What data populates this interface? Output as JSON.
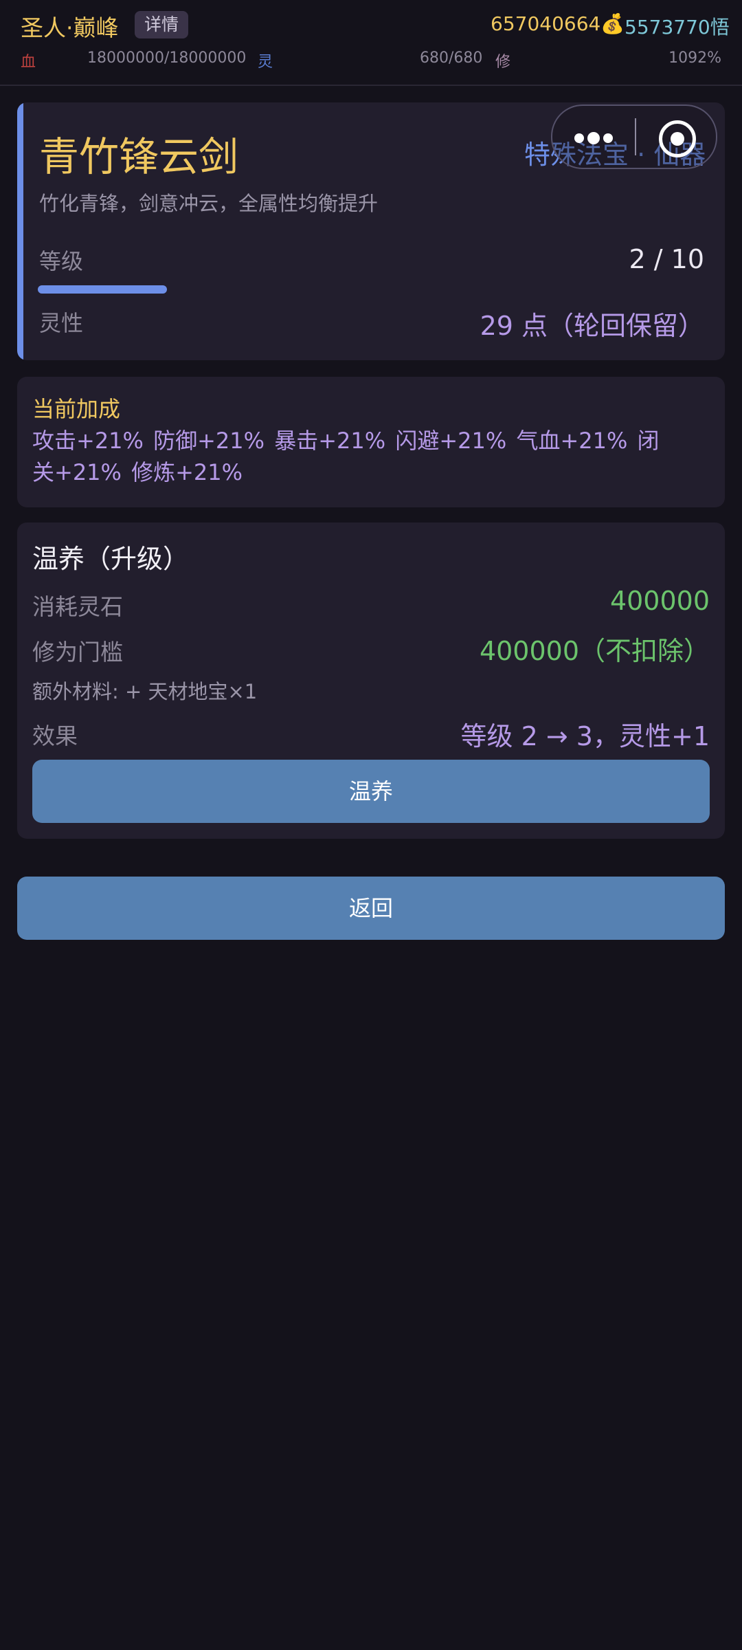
{
  "header": {
    "realm": "圣人·巅峰",
    "detail_label": "详情",
    "currency": "657040664💰",
    "wu": "5573770悟",
    "hp_label": "血",
    "hp_value": "18000000/18000000",
    "sp_label": "灵",
    "sp_value": "680/680",
    "xiu_label": "修",
    "xiu_value": "1092%"
  },
  "treasure": {
    "name": "青竹锋云剑",
    "type": "特殊法宝 · 仙器",
    "description": "竹化青锋，剑意冲云，全属性均衡提升",
    "level_label": "等级",
    "level_value": "2 / 10",
    "level_progress": 0.2,
    "spirit_label": "灵性",
    "spirit_value": "29 点（轮回保留）"
  },
  "bonus": {
    "title": "当前加成",
    "text": "攻击+21% 防御+21% 暴击+21% 闪避+21% 气血+21% 闭关+21% 修炼+21%"
  },
  "upgrade": {
    "title": "温养（升级）",
    "cost_label": "消耗灵石",
    "cost_value": "400000",
    "threshold_label": "修为门槛",
    "threshold_value": "400000（不扣除）",
    "extra": "额外材料: + 天材地宝×1",
    "effect_label": "效果",
    "effect_value": "等级 2 → 3，灵性+1",
    "button": "温养"
  },
  "back_button": "返回",
  "icons": {
    "menu": "more-dots-icon",
    "close": "target-close-icon"
  },
  "colors": {
    "background": "#14121b",
    "card": "#221e2d",
    "gold": "#f0c860",
    "accent_blue": "#6d8fe8",
    "purple": "#b69ae8",
    "green": "#6cc46c",
    "button": "#5681b2"
  }
}
